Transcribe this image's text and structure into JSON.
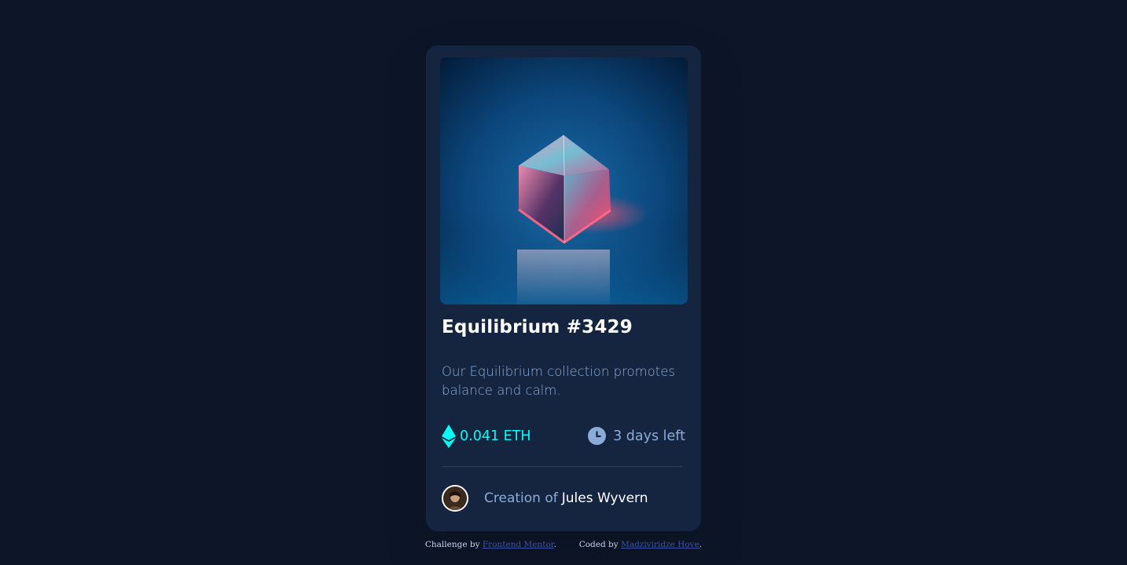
{
  "card": {
    "title": "Equilibrium #3429",
    "description": "Our Equilibrium collection promotes balance and calm.",
    "price": "0.041 ETH",
    "time_left": "3 days left",
    "creator_prefix": "Creation of",
    "creator_name": "Jules Wyvern"
  },
  "icons": {
    "price": "ethereum-icon",
    "time": "clock-icon"
  },
  "attribution": {
    "challenge_by": "Challenge by",
    "challenge_link": "Frontend Mentor",
    "period1": ".",
    "coded_by": "Coded by",
    "coded_link": "Madziviridze Hove",
    "period2": "."
  },
  "colors": {
    "page_bg": "#0d1628",
    "card_bg": "#15253f",
    "accent_cyan": "#00fff8",
    "soft_blue": "#8bacd9",
    "white": "#ffffff"
  }
}
